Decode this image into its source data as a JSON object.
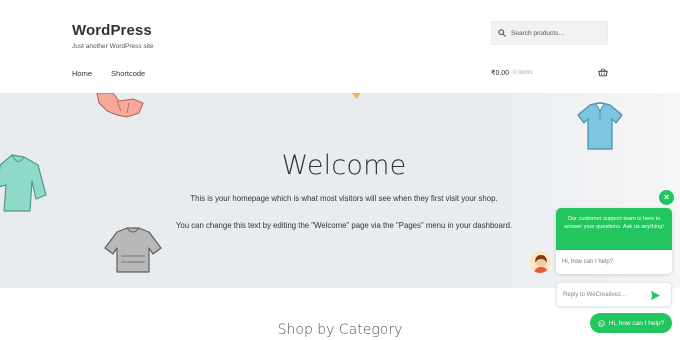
{
  "site": {
    "title": "WordPress",
    "description": "Just another WordPress site"
  },
  "search": {
    "placeholder": "Search products…",
    "icon": "search-icon"
  },
  "nav": {
    "items": [
      {
        "label": "Home"
      },
      {
        "label": "Shortcode"
      }
    ]
  },
  "cart": {
    "amount": "₹0.00",
    "count": "0 items",
    "icon": "basket-icon"
  },
  "hero": {
    "title": "Welcome",
    "paragraph1": "This is your homepage which is what most visitors will see when they first visit your shop.",
    "paragraph2": "You can change this text by editing the \"Welcome\" page via the \"Pages\" menu in your dashboard."
  },
  "section": {
    "title": "Shop by Category"
  },
  "chat": {
    "greeting": "Our customer support team is here to answer your questions. Ask us anything!",
    "prompt": "Hi, how can I help?",
    "reply_placeholder": "Reply to WeCreativez...",
    "whatsapp_label": "Hi, how can I help?",
    "close_symbol": "×"
  },
  "colors": {
    "accent_green": "#22c55e",
    "hero_bg": "#e9ecef"
  }
}
